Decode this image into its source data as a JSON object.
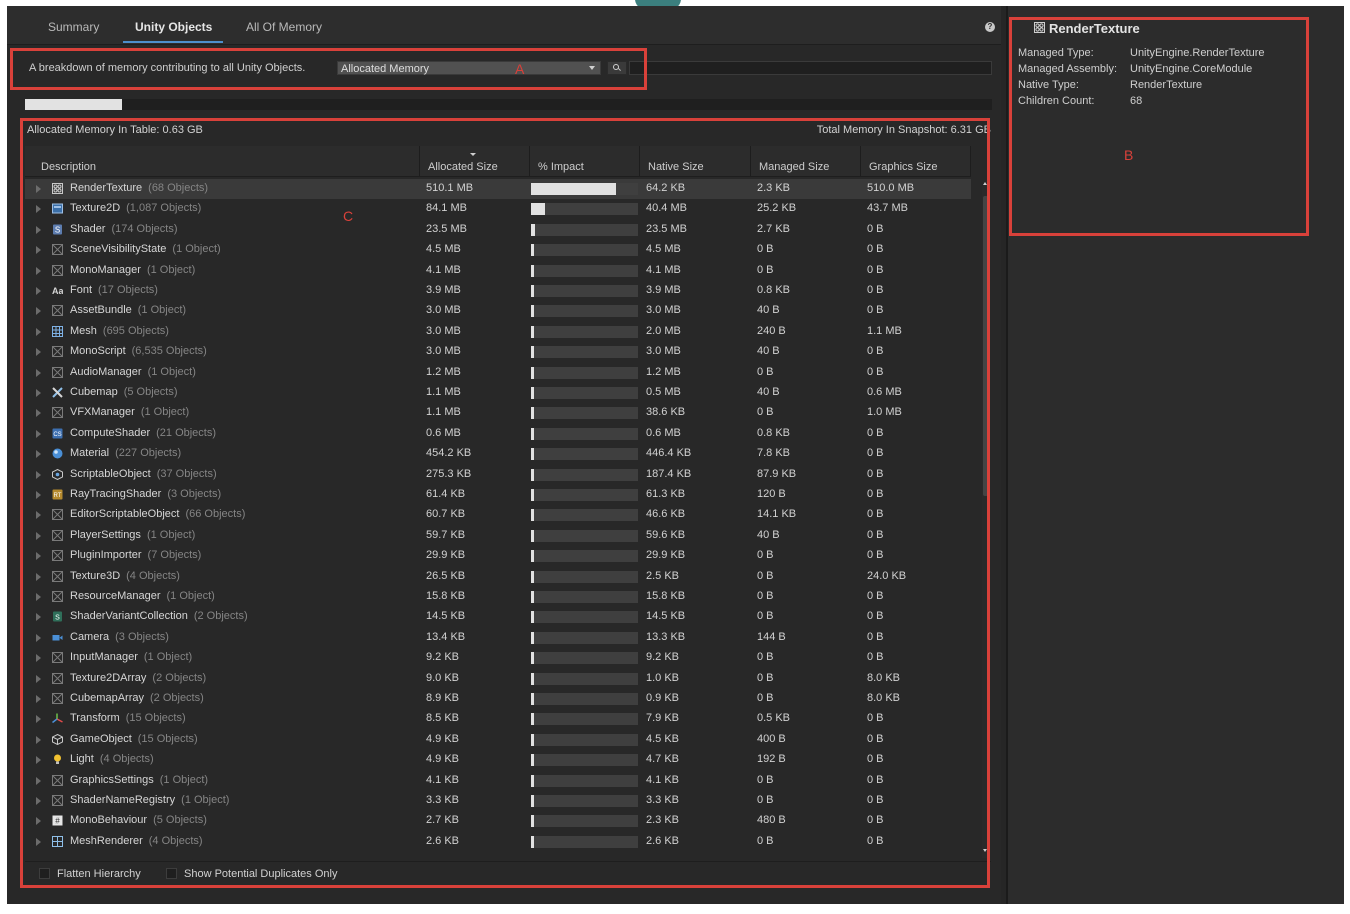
{
  "tabs": [
    {
      "label": "Summary"
    },
    {
      "label": "Unity Objects"
    },
    {
      "label": "All Of Memory"
    }
  ],
  "active_tab": "Unity Objects",
  "toolbar": {
    "description": "A breakdown of memory contributing to all Unity Objects.",
    "dropdown_value": "Allocated Memory",
    "search_value": ""
  },
  "progress": {
    "fraction": 0.1
  },
  "table": {
    "allocated_in_table": "Allocated Memory In Table: 0.63 GB",
    "total_in_snapshot": "Total Memory In Snapshot: 6.31 GB",
    "columns": [
      "Description",
      "Allocated Size",
      "% Impact",
      "Native Size",
      "Managed Size",
      "Graphics Size"
    ],
    "rows": [
      {
        "name": "RenderTexture",
        "count": "(68 Objects)",
        "allocated": "510.1 MB",
        "impact": 0.806,
        "native": "64.2 KB",
        "managed": "2.3 KB",
        "graphics": "510.0 MB",
        "icon": "render-texture"
      },
      {
        "name": "Texture2D",
        "count": "(1,087 Objects)",
        "allocated": "84.1 MB",
        "impact": 0.133,
        "native": "40.4 MB",
        "managed": "25.2 KB",
        "graphics": "43.7 MB",
        "icon": "texture2d"
      },
      {
        "name": "Shader",
        "count": "(174 Objects)",
        "allocated": "23.5 MB",
        "impact": 0.037,
        "native": "23.5 MB",
        "managed": "2.7 KB",
        "graphics": "0 B",
        "icon": "shader"
      },
      {
        "name": "SceneVisibilityState",
        "count": "(1 Object)",
        "allocated": "4.5 MB",
        "impact": 0.007,
        "native": "4.5 MB",
        "managed": "0 B",
        "graphics": "0 B",
        "icon": "generic"
      },
      {
        "name": "MonoManager",
        "count": "(1 Object)",
        "allocated": "4.1 MB",
        "impact": 0.006,
        "native": "4.1 MB",
        "managed": "0 B",
        "graphics": "0 B",
        "icon": "generic"
      },
      {
        "name": "Font",
        "count": "(17 Objects)",
        "allocated": "3.9 MB",
        "impact": 0.006,
        "native": "3.9 MB",
        "managed": "0.8 KB",
        "graphics": "0 B",
        "icon": "font"
      },
      {
        "name": "AssetBundle",
        "count": "(1 Object)",
        "allocated": "3.0 MB",
        "impact": 0.005,
        "native": "3.0 MB",
        "managed": "40 B",
        "graphics": "0 B",
        "icon": "generic"
      },
      {
        "name": "Mesh",
        "count": "(695 Objects)",
        "allocated": "3.0 MB",
        "impact": 0.005,
        "native": "2.0 MB",
        "managed": "240 B",
        "graphics": "1.1 MB",
        "icon": "mesh"
      },
      {
        "name": "MonoScript",
        "count": "(6,535 Objects)",
        "allocated": "3.0 MB",
        "impact": 0.005,
        "native": "3.0 MB",
        "managed": "40 B",
        "graphics": "0 B",
        "icon": "generic"
      },
      {
        "name": "AudioManager",
        "count": "(1 Object)",
        "allocated": "1.2 MB",
        "impact": 0.002,
        "native": "1.2 MB",
        "managed": "0 B",
        "graphics": "0 B",
        "icon": "generic"
      },
      {
        "name": "Cubemap",
        "count": "(5 Objects)",
        "allocated": "1.1 MB",
        "impact": 0.002,
        "native": "0.5 MB",
        "managed": "40 B",
        "graphics": "0.6 MB",
        "icon": "cubemap"
      },
      {
        "name": "VFXManager",
        "count": "(1 Object)",
        "allocated": "1.1 MB",
        "impact": 0.002,
        "native": "38.6 KB",
        "managed": "0 B",
        "graphics": "1.0 MB",
        "icon": "generic"
      },
      {
        "name": "ComputeShader",
        "count": "(21 Objects)",
        "allocated": "0.6 MB",
        "impact": 0.001,
        "native": "0.6 MB",
        "managed": "0.8 KB",
        "graphics": "0 B",
        "icon": "compute-shader"
      },
      {
        "name": "Material",
        "count": "(227 Objects)",
        "allocated": "454.2 KB",
        "impact": 0.001,
        "native": "446.4 KB",
        "managed": "7.8 KB",
        "graphics": "0 B",
        "icon": "material"
      },
      {
        "name": "ScriptableObject",
        "count": "(37 Objects)",
        "allocated": "275.3 KB",
        "impact": 0.0005,
        "native": "187.4 KB",
        "managed": "87.9 KB",
        "graphics": "0 B",
        "icon": "scriptable-object"
      },
      {
        "name": "RayTracingShader",
        "count": "(3 Objects)",
        "allocated": "61.4 KB",
        "impact": 0.0001,
        "native": "61.3 KB",
        "managed": "120 B",
        "graphics": "0 B",
        "icon": "raytracing-shader"
      },
      {
        "name": "EditorScriptableObject",
        "count": "(66 Objects)",
        "allocated": "60.7 KB",
        "impact": 0.0001,
        "native": "46.6 KB",
        "managed": "14.1 KB",
        "graphics": "0 B",
        "icon": "generic"
      },
      {
        "name": "PlayerSettings",
        "count": "(1 Object)",
        "allocated": "59.7 KB",
        "impact": 0.0001,
        "native": "59.6 KB",
        "managed": "40 B",
        "graphics": "0 B",
        "icon": "generic"
      },
      {
        "name": "PluginImporter",
        "count": "(7 Objects)",
        "allocated": "29.9 KB",
        "impact": 0.0001,
        "native": "29.9 KB",
        "managed": "0 B",
        "graphics": "0 B",
        "icon": "generic"
      },
      {
        "name": "Texture3D",
        "count": "(4 Objects)",
        "allocated": "26.5 KB",
        "impact": 0.0001,
        "native": "2.5 KB",
        "managed": "0 B",
        "graphics": "24.0 KB",
        "icon": "generic"
      },
      {
        "name": "ResourceManager",
        "count": "(1 Object)",
        "allocated": "15.8 KB",
        "impact": 0.0001,
        "native": "15.8 KB",
        "managed": "0 B",
        "graphics": "0 B",
        "icon": "generic"
      },
      {
        "name": "ShaderVariantCollection",
        "count": "(2 Objects)",
        "allocated": "14.5 KB",
        "impact": 0.0001,
        "native": "14.5 KB",
        "managed": "0 B",
        "graphics": "0 B",
        "icon": "shader-variant"
      },
      {
        "name": "Camera",
        "count": "(3 Objects)",
        "allocated": "13.4 KB",
        "impact": 0.0001,
        "native": "13.3 KB",
        "managed": "144 B",
        "graphics": "0 B",
        "icon": "camera"
      },
      {
        "name": "InputManager",
        "count": "(1 Object)",
        "allocated": "9.2 KB",
        "impact": 0.0001,
        "native": "9.2 KB",
        "managed": "0 B",
        "graphics": "0 B",
        "icon": "generic"
      },
      {
        "name": "Texture2DArray",
        "count": "(2 Objects)",
        "allocated": "9.0 KB",
        "impact": 0.0001,
        "native": "1.0 KB",
        "managed": "0 B",
        "graphics": "8.0 KB",
        "icon": "generic"
      },
      {
        "name": "CubemapArray",
        "count": "(2 Objects)",
        "allocated": "8.9 KB",
        "impact": 0.0001,
        "native": "0.9 KB",
        "managed": "0 B",
        "graphics": "8.0 KB",
        "icon": "generic"
      },
      {
        "name": "Transform",
        "count": "(15 Objects)",
        "allocated": "8.5 KB",
        "impact": 0.0001,
        "native": "7.9 KB",
        "managed": "0.5 KB",
        "graphics": "0 B",
        "icon": "transform"
      },
      {
        "name": "GameObject",
        "count": "(15 Objects)",
        "allocated": "4.9 KB",
        "impact": 0.0001,
        "native": "4.5 KB",
        "managed": "400 B",
        "graphics": "0 B",
        "icon": "gameobject"
      },
      {
        "name": "Light",
        "count": "(4 Objects)",
        "allocated": "4.9 KB",
        "impact": 0.0001,
        "native": "4.7 KB",
        "managed": "192 B",
        "graphics": "0 B",
        "icon": "light"
      },
      {
        "name": "GraphicsSettings",
        "count": "(1 Object)",
        "allocated": "4.1 KB",
        "impact": 0.0001,
        "native": "4.1 KB",
        "managed": "0 B",
        "graphics": "0 B",
        "icon": "generic"
      },
      {
        "name": "ShaderNameRegistry",
        "count": "(1 Object)",
        "allocated": "3.3 KB",
        "impact": 0.0001,
        "native": "3.3 KB",
        "managed": "0 B",
        "graphics": "0 B",
        "icon": "generic"
      },
      {
        "name": "MonoBehaviour",
        "count": "(5 Objects)",
        "allocated": "2.7 KB",
        "impact": 0.0001,
        "native": "2.3 KB",
        "managed": "480 B",
        "graphics": "0 B",
        "icon": "monobehaviour"
      },
      {
        "name": "MeshRenderer",
        "count": "(4 Objects)",
        "allocated": "2.6 KB",
        "impact": 0.0001,
        "native": "2.6 KB",
        "managed": "0 B",
        "graphics": "0 B",
        "icon": "mesh-renderer"
      }
    ]
  },
  "footer": {
    "flatten_label": "Flatten Hierarchy",
    "flatten_checked": false,
    "duplicates_label": "Show Potential Duplicates Only",
    "duplicates_checked": false
  },
  "details": {
    "title": "RenderTexture",
    "fields": [
      {
        "label": "Managed Type:",
        "value": "UnityEngine.RenderTexture"
      },
      {
        "label": "Managed Assembly:",
        "value": "UnityEngine.CoreModule"
      },
      {
        "label": "Native Type:",
        "value": "RenderTexture"
      },
      {
        "label": "Children Count:",
        "value": "68"
      }
    ]
  },
  "annotations": {
    "a": "A",
    "b": "B",
    "c": "C"
  },
  "colors": {
    "annotation_red": "#d9413a",
    "selection": "#3a3a3a",
    "accent": "#4d8fcc"
  }
}
